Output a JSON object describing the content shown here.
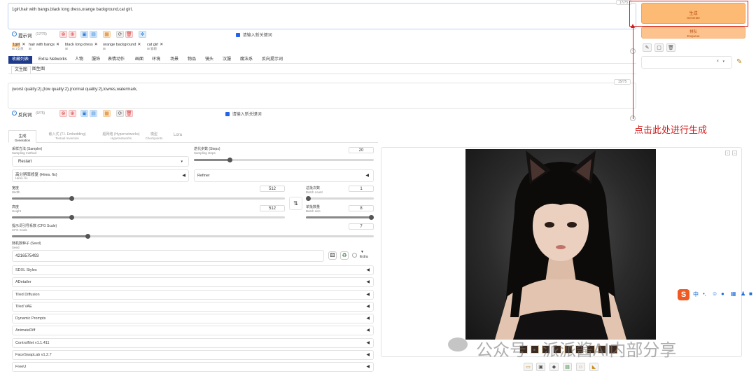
{
  "prompt": {
    "text": "1girl,hair with bangs,black long dress,orange background,cat girl,",
    "counter": "17/75",
    "label": "提示词",
    "count": "(17/75)",
    "keyword_placeholder": "请输入新关键词",
    "tags": [
      {
        "label": "1girl",
        "sub": "1女孩"
      },
      {
        "label": "hair with bangs",
        "sub": ""
      },
      {
        "label": "black long dress",
        "sub": ""
      },
      {
        "label": "orange background",
        "sub": ""
      },
      {
        "label": "cat girl",
        "sub": "猫娘"
      }
    ]
  },
  "negative": {
    "text": "(worst quality:2),(low quality:2),(normal quality:2),lowres,watermark,",
    "counter": "15/75",
    "label": "反向词",
    "count": "(0/75)",
    "keyword_placeholder": "请输入新关键词"
  },
  "generate": {
    "label": "生成",
    "sub": "Generate"
  },
  "enqueue": {
    "label": "排队",
    "sub": "Enqueue"
  },
  "annotation": "点击此处进行生成",
  "category_tabs": [
    "收藏列表",
    "Extra Networks",
    "人物",
    "服饰",
    "表情动作",
    "画面",
    "环境",
    "场景",
    "物品",
    "镜头",
    "汉服",
    "魔法系",
    "反向提示词"
  ],
  "mode_tabs": [
    "文生图",
    "图生图"
  ],
  "gen_tabs": [
    {
      "label": "生成",
      "sub": "Generation"
    },
    {
      "label": "嵌入式 (T.I. Embedding)",
      "sub": "Textual Inversion"
    },
    {
      "label": "超网络 (Hypernetworks)",
      "sub": "Hypernetworks"
    },
    {
      "label": "模型",
      "sub": "Checkpoints"
    },
    {
      "label": "Lora",
      "sub": ""
    }
  ],
  "params": {
    "sampler_label": "采样方法 (Sampler)",
    "sampler_sub": "Sampling method",
    "sampler_value": "Restart",
    "steps_label": "迭代步数 (Steps)",
    "steps_sub": "Sampling steps",
    "steps_value": "20",
    "steps_level": 0.2,
    "hires_label": "高分辨率修复 (Hires. fix)",
    "hires_sub": "Hires. fix",
    "refiner_label": "Refiner",
    "width_label": "宽度",
    "width_sub": "Width",
    "width_value": "512",
    "width_level": 0.22,
    "height_label": "高度",
    "height_sub": "Height",
    "height_value": "512",
    "height_level": 0.22,
    "swap_icon": "⇅",
    "batch_count_label": "总批次数",
    "batch_count_sub": "Batch count",
    "batch_count_value": "1",
    "batch_count_level": 0.0,
    "batch_size_label": "单批数量",
    "batch_size_sub": "Batch size",
    "batch_size_value": "8",
    "batch_size_level": 1.0,
    "cfg_label": "提示词引导系数 (CFG Scale)",
    "cfg_sub": "CFG Scale",
    "cfg_value": "7",
    "cfg_level": 0.21,
    "seed_label": "随机数种子 (Seed)",
    "seed_sub": "Seed",
    "seed_value": "4216575493",
    "extra_label": "Extra"
  },
  "accordions": [
    "SDXL Styles",
    "ADetailer",
    "Tiled Diffusion",
    "Tiled VAE",
    "Dynamic Prompts",
    "AnimateDiff",
    "ControlNet v1.1.411",
    "FaceSwapLab v1.2.7",
    "FreeU"
  ],
  "watermark": "公众号 · 派派酱AI内部分享",
  "ime_bar": {
    "logo": "S",
    "lang": "中"
  },
  "colors": {
    "accent": "#f97316",
    "generate_bg": "#fdba74",
    "annotation": "#d11c1c",
    "tab_active": "#1e3a8a"
  }
}
